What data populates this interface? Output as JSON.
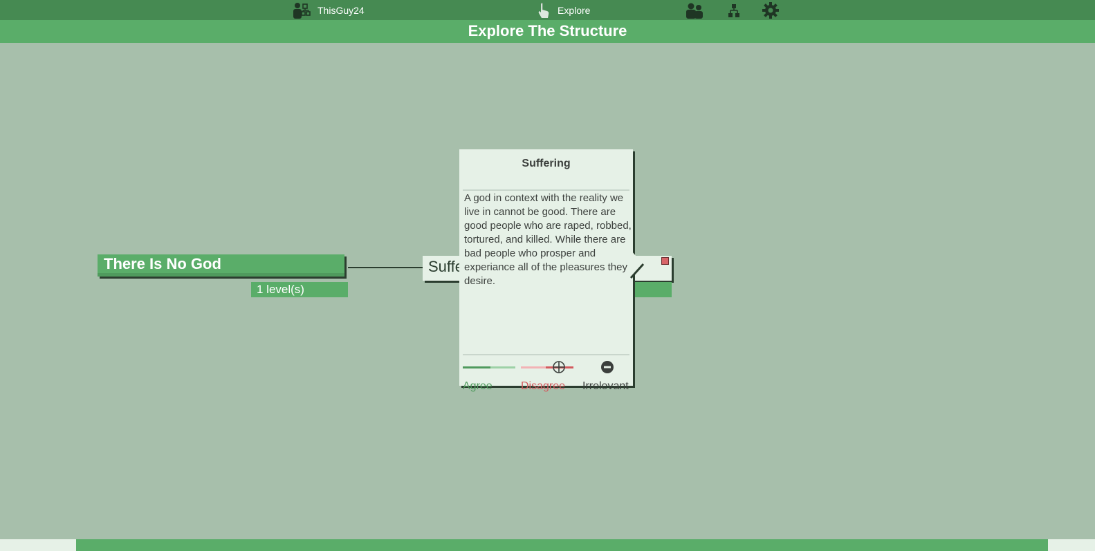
{
  "nav": {
    "user_label": "ThisGuy24",
    "explore_label": "Explore",
    "icons": [
      "user-tree-icon",
      "explore-hand-icon",
      "group-icon",
      "hierarchy-icon",
      "gear-icon"
    ]
  },
  "page": {
    "title": "Explore The Structure"
  },
  "tree": {
    "root": {
      "title": "There Is No God",
      "levels_label": "1 level(s)"
    },
    "child": {
      "title": "Suffering"
    }
  },
  "popup": {
    "title": "Suffering",
    "body": "A god in context with the reality we live in cannot be good. There are good people who are raped, robbed, tortured, and killed. While there are bad people who prosper and experiance all of the pleasures they desire.",
    "agree_label": "Agree",
    "disagree_label": "Disagree",
    "irrelevant_label": "Irrelevant",
    "agree_level": 0.53,
    "disagree_level": 0.53
  },
  "colors": {
    "topbar": "#468a52",
    "titlebar": "#5aad69",
    "background": "#a7bfab",
    "agree": "#4f9a5d",
    "disagree": "#d35a5e"
  }
}
